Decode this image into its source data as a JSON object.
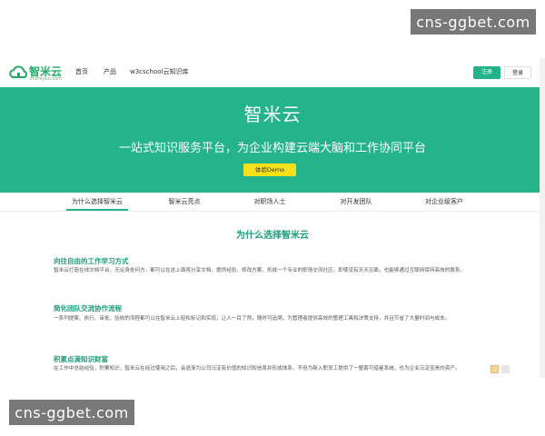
{
  "watermark": {
    "top_text": "cns-ggbet.com",
    "bottom_text": "cns-ggbet.com"
  },
  "logo": {
    "name": "智米云",
    "domain": "zhimiyun.com",
    "icon": "cloud-icon",
    "color": "#22aa66"
  },
  "nav": {
    "links": [
      "首页",
      "产品",
      "w3cschool云知识库"
    ],
    "register_label": "注册",
    "login_label": "登录"
  },
  "hero": {
    "title": "智米云",
    "subtitle": "一站式知识服务平台，为企业构建云端大脑和工作协同平台",
    "demo_button": "体验Demo",
    "background": "#25b38c",
    "button_color": "#f7e11a"
  },
  "tabs": [
    {
      "label": "为什么选择智米云",
      "active": true
    },
    {
      "label": "智米云亮点",
      "active": false
    },
    {
      "label": "对职场人士",
      "active": false
    },
    {
      "label": "对开发团队",
      "active": false
    },
    {
      "label": "对企业级客户",
      "active": false
    }
  ],
  "content": {
    "section_title": "为什么选择智米云",
    "items": [
      {
        "heading": "向往自由的工作学习方式",
        "text": "智米云打造在线文档平台，无论身处何方，都可以在这上面将分享文档，提供经验，修改方案，形成一个专业的职场交流社区。即使没有天天见面，也能够通过互联网保持高效的联系。"
      },
      {
        "heading": "简化团队交流协作流程",
        "text": "一系列提案、执行、审批、验收的流程都可以在智米云上轻松标记和实现，让人一目了然，随时可追溯，为管理者提供高效的管理工具和决策支持，并且节省了大量时间与成本。"
      },
      {
        "heading": "积累点滴知识财富",
        "text": "在工作中总结经验，积累知识，智米云在经过使用之后，会逐渐为公司沉淀有价值的知识和信息并形成体系，不但为新入职员工提供了一整套可借鉴系统，也为企业沉淀宝贵的资产。"
      }
    ]
  },
  "accent_color": "#1e9e78"
}
